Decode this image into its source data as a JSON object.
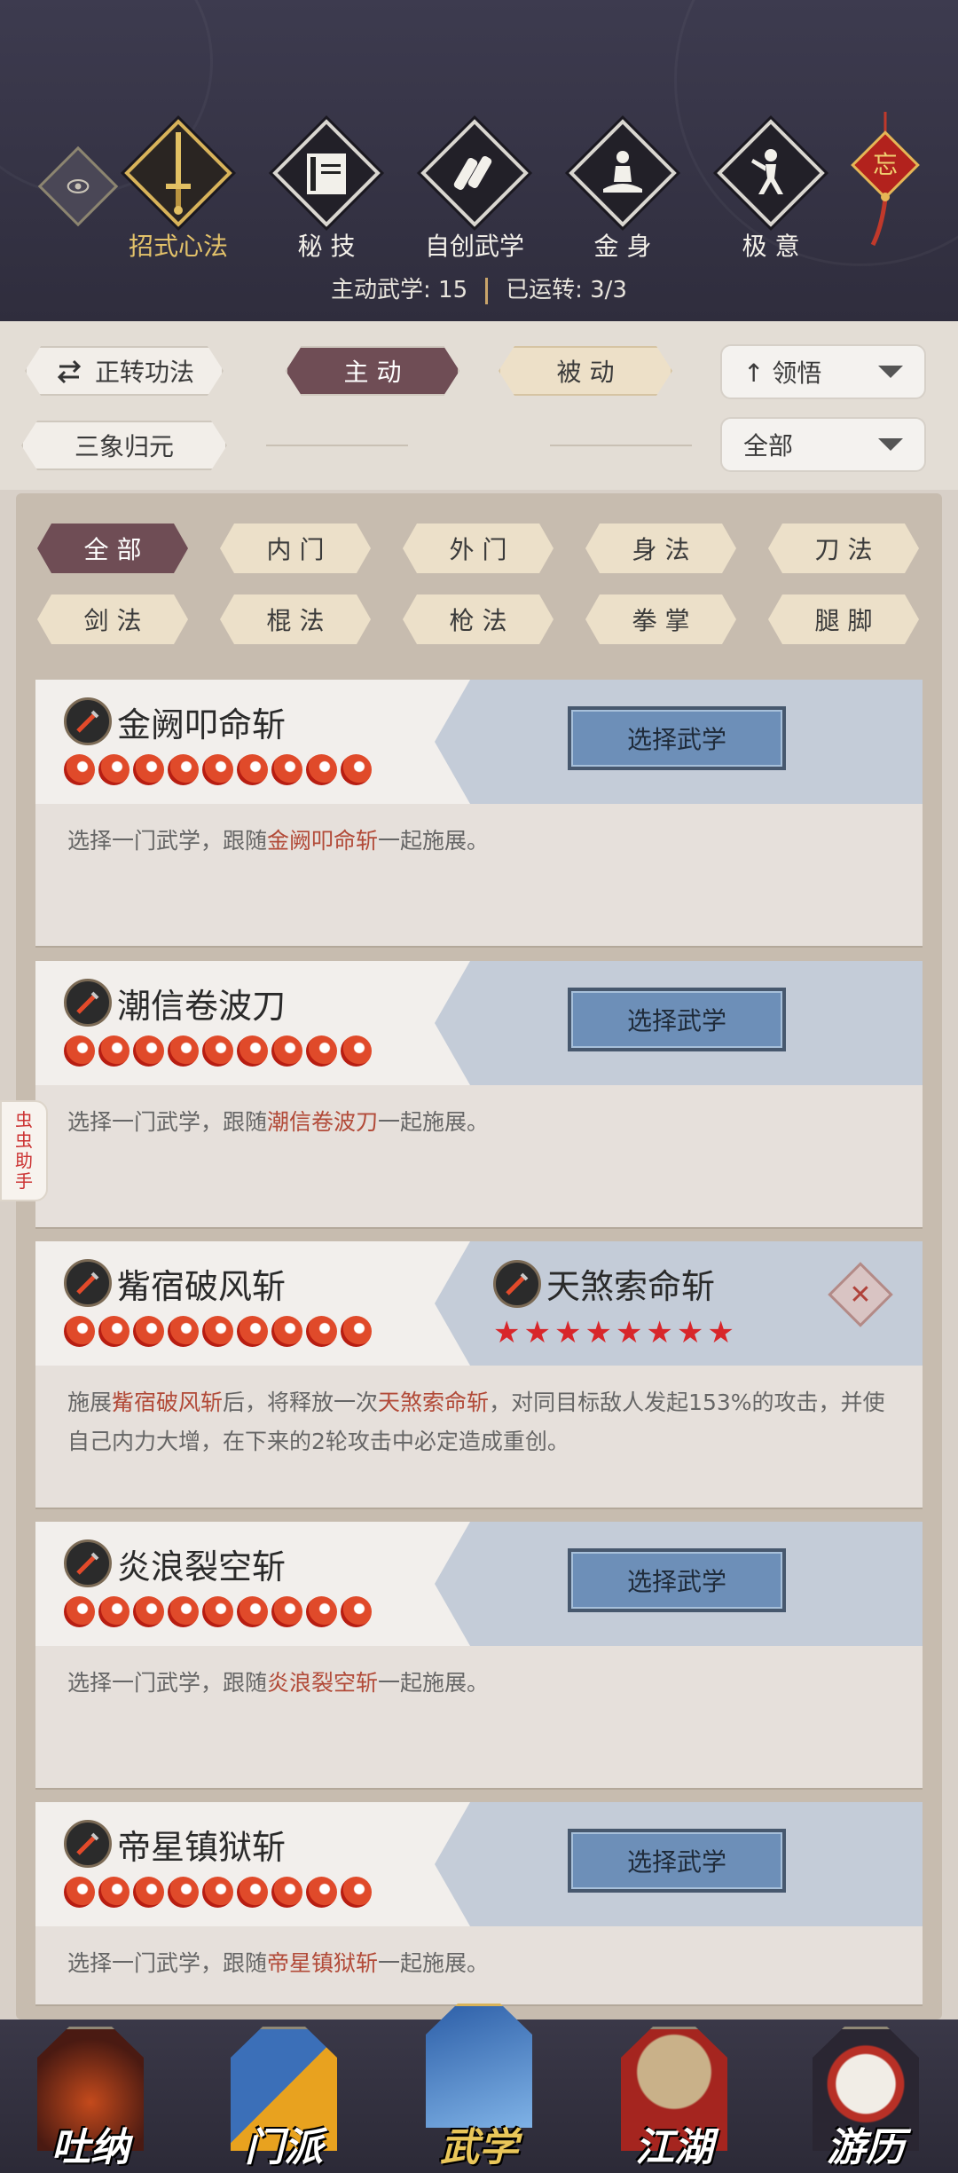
{
  "header": {
    "nav_items": [
      {
        "label": "招式心法",
        "icon": "sword-icon",
        "active": true
      },
      {
        "label": "秘 技",
        "icon": "book-icon",
        "active": false
      },
      {
        "label": "自创武学",
        "icon": "scroll-icon",
        "active": false
      },
      {
        "label": "金 身",
        "icon": "meditation-icon",
        "active": false
      },
      {
        "label": "极 意",
        "icon": "martial-pose-icon",
        "active": false
      }
    ],
    "knot_label": "忘",
    "stats": {
      "active_label": "主动武学: 15",
      "running_label": "已运转: 3/3"
    }
  },
  "filters": {
    "switch_label": "正转功法",
    "mode_active": "主 动",
    "mode_passive": "被 动",
    "sort_label": "领悟",
    "sanxiang_label": "三象归元",
    "scope_label": "全部"
  },
  "categories": [
    "全 部",
    "内 门",
    "外 门",
    "身 法",
    "刀 法",
    "剑 法",
    "棍 法",
    "枪 法",
    "拳 掌",
    "腿 脚"
  ],
  "cards": [
    {
      "name": "金阙叩命斩",
      "button": "选择武学",
      "desc_pre": "选择一门武学，跟随",
      "desc_hl": "金阙叩命斩",
      "desc_post": "一起施展。"
    },
    {
      "name": "潮信卷波刀",
      "button": "选择武学",
      "desc_pre": "选择一门武学，跟随",
      "desc_hl": "潮信卷波刀",
      "desc_post": "一起施展。"
    },
    {
      "name": "觜宿破风斩",
      "chosen": "天煞索命斩",
      "desc_a": "施展",
      "desc_b": "觜宿破风斩",
      "desc_c": "后，将释放一次",
      "desc_d": "天煞索命斩",
      "desc_e": "，对同目标敌人发起153%的攻击，并使自己内力大增，在下来的2轮攻击中必定造成重创。"
    },
    {
      "name": "炎浪裂空斩",
      "button": "选择武学",
      "desc_pre": "选择一门武学，跟随",
      "desc_hl": "炎浪裂空斩",
      "desc_post": "一起施展。"
    },
    {
      "name": "帝星镇狱斩",
      "button": "选择武学",
      "desc_pre": "选择一门武学，跟随",
      "desc_hl": "帝星镇狱斩",
      "desc_post": "一起施展。"
    }
  ],
  "helper": {
    "c1": "虫",
    "c2": "虫",
    "c3": "助",
    "c4": "手"
  },
  "bottom_nav": [
    {
      "label": "吐纳",
      "active": false
    },
    {
      "label": "门派",
      "active": false
    },
    {
      "label": "武学",
      "active": true
    },
    {
      "label": "江湖",
      "active": false
    },
    {
      "label": "游历",
      "active": false
    }
  ],
  "colors": {
    "accent_active": "#6f4d55",
    "highlight_text": "#b24a38",
    "button_blue": "#6d8fb8"
  }
}
